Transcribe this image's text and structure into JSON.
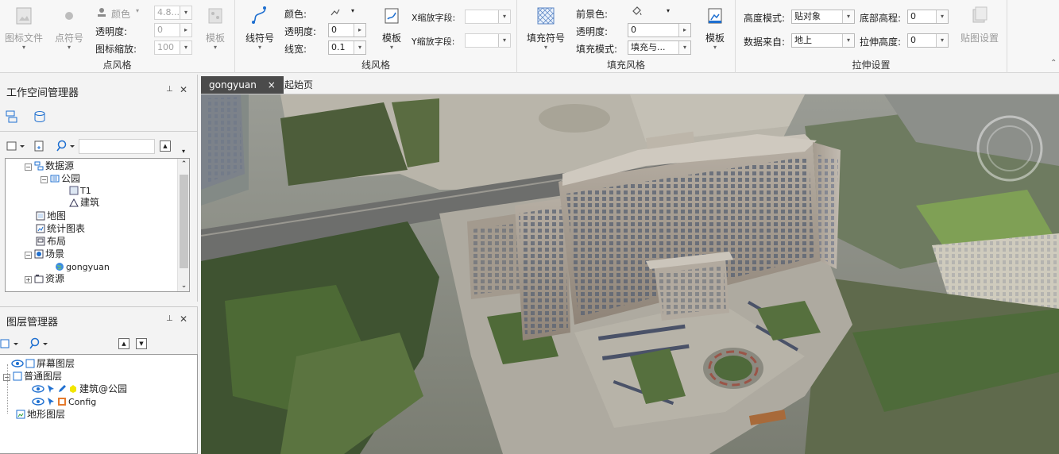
{
  "ribbon": {
    "point_group": {
      "title": "点风格",
      "icon_file": "图标文件",
      "point_symbol": "点符号",
      "color_label": "颜色",
      "transparency_label": "透明度:",
      "transparency_value": "0",
      "icon_scale_label": "图标缩放:",
      "icon_scale_value": "100",
      "size_value": "4.8...",
      "template": "模板"
    },
    "line_group": {
      "title": "线风格",
      "line_symbol": "线符号",
      "color_label": "颜色:",
      "transparency_label": "透明度:",
      "transparency_value": "0",
      "width_label": "线宽:",
      "width_value": "0.1",
      "template": "模板",
      "x_scale_label": "X缩放字段:",
      "y_scale_label": "Y缩放字段:"
    },
    "fill_group": {
      "title": "填充风格",
      "fill_symbol": "填充符号",
      "foreground_label": "前景色:",
      "transparency_label": "透明度:",
      "transparency_value": "0",
      "fill_mode_label": "填充模式:",
      "fill_mode_value": "填充与...",
      "template": "模板"
    },
    "extrude_group": {
      "title": "拉伸设置",
      "height_mode_label": "高度模式:",
      "height_mode_value": "贴对象",
      "bottom_elev_label": "底部高程:",
      "bottom_elev_value": "0",
      "data_from_label": "数据来自:",
      "data_from_value": "地上",
      "extrude_height_label": "拉伸高度:",
      "extrude_height_value": "0",
      "texture_settings": "贴图设置"
    }
  },
  "workspace": {
    "title": "工作空间管理器",
    "pin": "ᵖ",
    "close": "✕",
    "tree": {
      "datasource": "数据源",
      "park": "公园",
      "t1": "T1",
      "building": "建筑",
      "map": "地图",
      "chart": "统计图表",
      "layout": "布局",
      "scene": "场景",
      "gongyuan": "gongyuan",
      "resource": "资源"
    }
  },
  "layers": {
    "title": "图层管理器",
    "screen_layer": "屏幕图层",
    "normal_layer": "普通图层",
    "building_layer": "建筑@公园",
    "config_layer": "Config",
    "terrain_layer": "地形图层"
  },
  "tabs": [
    {
      "label": "gongyuan",
      "close": "×"
    },
    {
      "label": "起始页"
    }
  ],
  "colors": {
    "active_tab": "#4b4b4b",
    "accent_blue": "#1e6fd0"
  }
}
